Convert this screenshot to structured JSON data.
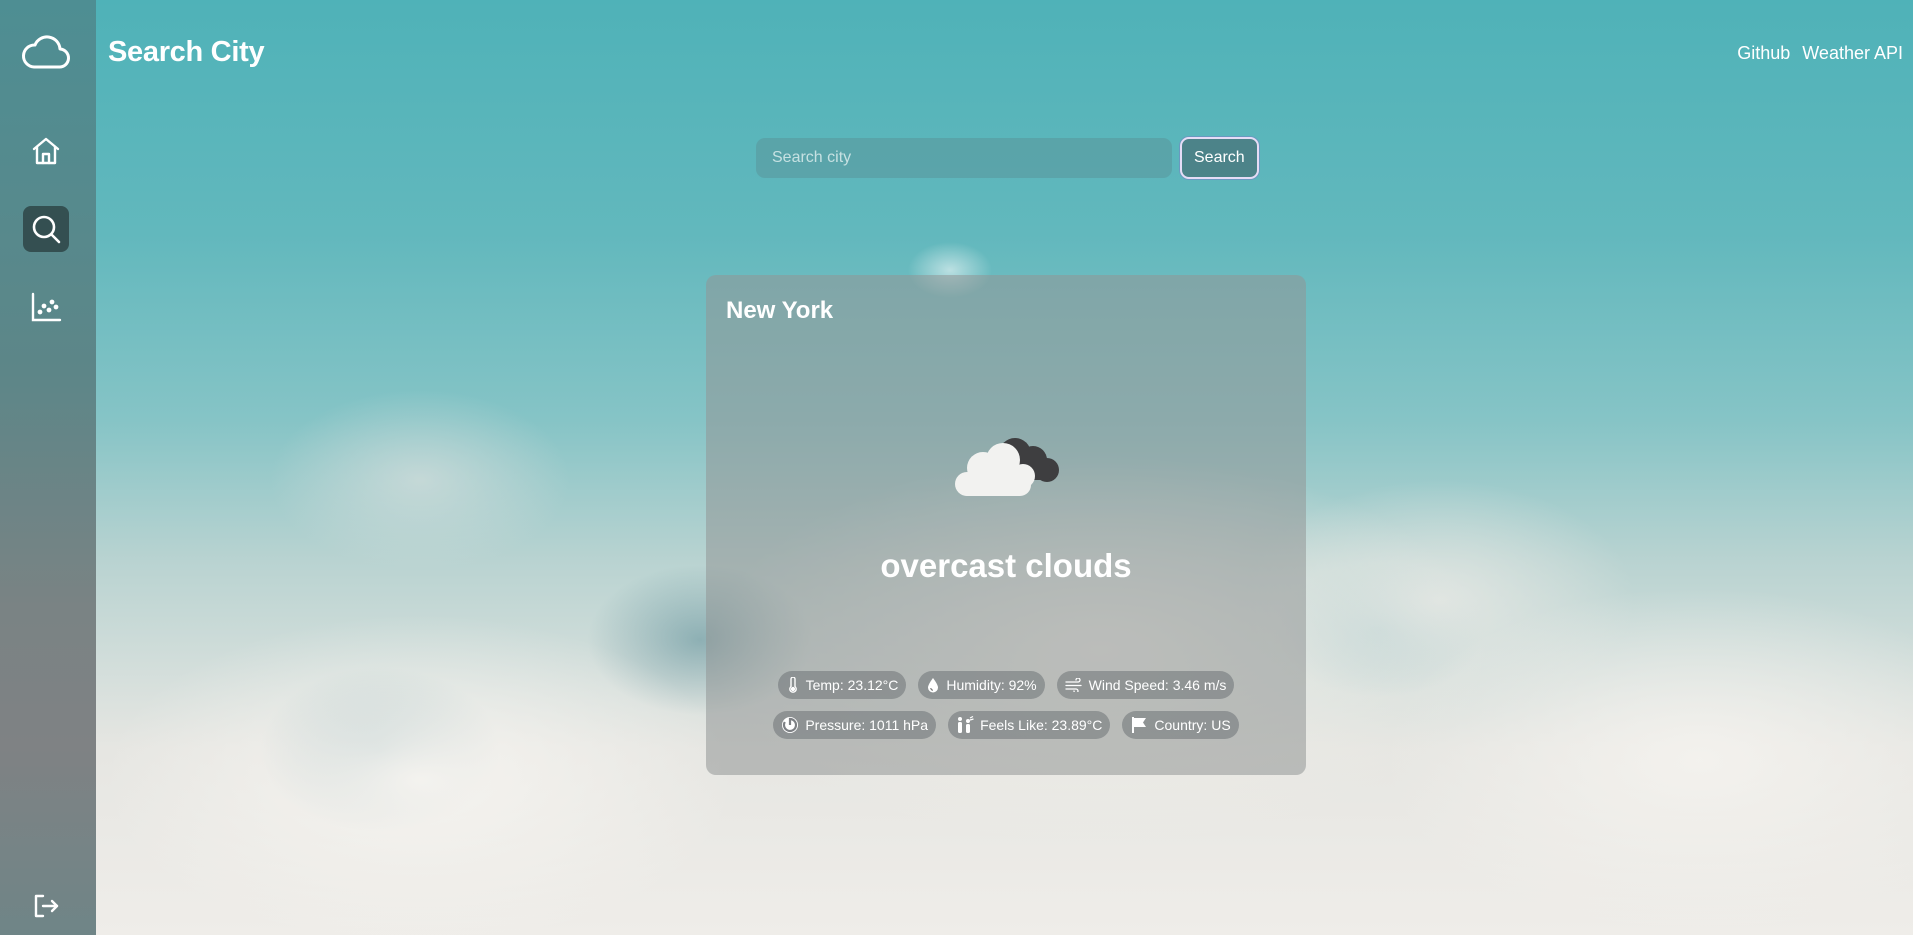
{
  "header": {
    "title": "Search City",
    "links": [
      "Github",
      "Weather API"
    ]
  },
  "sidebar": {
    "items": [
      {
        "icon": "cloud-logo-icon",
        "active": false
      },
      {
        "icon": "home-icon",
        "active": false
      },
      {
        "icon": "search-icon",
        "active": true
      },
      {
        "icon": "scatter-chart-icon",
        "active": false
      },
      {
        "icon": "logout-icon",
        "active": false
      }
    ]
  },
  "search": {
    "placeholder": "Search city",
    "value": "",
    "button_label": "Search"
  },
  "weather_card": {
    "city": "New York",
    "icon": "overcast-clouds-icon",
    "description": "overcast clouds",
    "stats": {
      "temp": "Temp: 23.12°C",
      "humidity": "Humidity: 92%",
      "wind": "Wind Speed: 3.46 m/s",
      "pressure": "Pressure: 1011 hPa",
      "feels_like": "Feels Like: 23.89°C",
      "country": "Country: US"
    }
  },
  "colors": {
    "sidebar_active": "#2f4547",
    "search_button_border": "#e6dcf6",
    "card_bg": "#91969a"
  }
}
